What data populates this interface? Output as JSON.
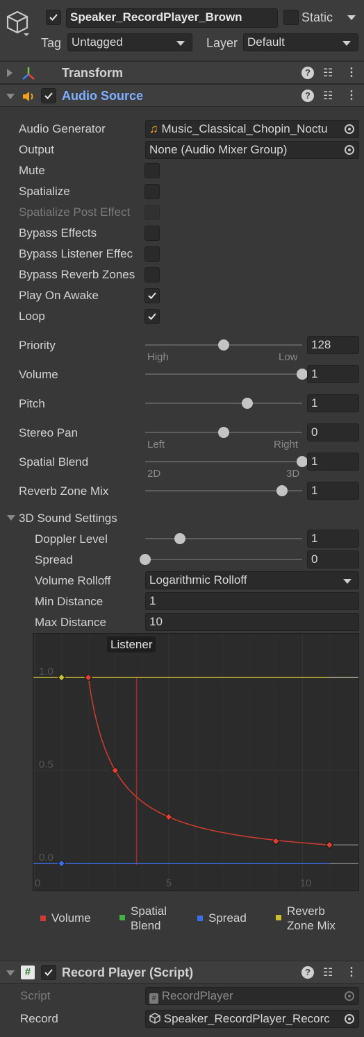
{
  "object": {
    "name": "Speaker_RecordPlayer_Brown",
    "static_label": "Static",
    "tag_label": "Tag",
    "tag_value": "Untagged",
    "layer_label": "Layer",
    "layer_value": "Default"
  },
  "transform": {
    "title": "Transform"
  },
  "audio_source": {
    "title": "Audio Source",
    "audio_generator_label": "Audio Generator",
    "audio_generator_value": "Music_Classical_Chopin_Noctu",
    "output_label": "Output",
    "output_value": "None (Audio Mixer Group)",
    "mute_label": "Mute",
    "spatialize_label": "Spatialize",
    "spatialize_post_label": "Spatialize Post Effect",
    "bypass_effects_label": "Bypass Effects",
    "bypass_listener_label": "Bypass Listener Effec",
    "bypass_reverb_label": "Bypass Reverb Zones",
    "play_on_awake_label": "Play On Awake",
    "loop_label": "Loop",
    "checks": {
      "mute": false,
      "spatialize": false,
      "spatialize_post": false,
      "bypass_effects": false,
      "bypass_listener": false,
      "bypass_reverb": false,
      "play_on_awake": true,
      "loop": true
    },
    "priority": {
      "label": "Priority",
      "value": "128",
      "min_hint": "High",
      "max_hint": "Low",
      "fraction": 0.5
    },
    "volume": {
      "label": "Volume",
      "value": "1",
      "fraction": 1.0
    },
    "pitch": {
      "label": "Pitch",
      "value": "1",
      "fraction": 0.65
    },
    "stereo_pan": {
      "label": "Stereo Pan",
      "value": "0",
      "min_hint": "Left",
      "max_hint": "Right",
      "fraction": 0.5
    },
    "spatial_blend": {
      "label": "Spatial Blend",
      "value": "1",
      "min_hint": "2D",
      "max_hint": "3D",
      "fraction": 1.0
    },
    "reverb_zone_mix": {
      "label": "Reverb Zone Mix",
      "value": "1",
      "fraction": 0.87
    }
  },
  "sound3d": {
    "title": "3D Sound Settings",
    "doppler": {
      "label": "Doppler Level",
      "value": "1",
      "fraction": 0.22
    },
    "spread": {
      "label": "Spread",
      "value": "0",
      "fraction": 0.0
    },
    "rolloff_label": "Volume Rolloff",
    "rolloff_value": "Logarithmic Rolloff",
    "min_distance_label": "Min Distance",
    "min_distance_value": "1",
    "max_distance_label": "Max Distance",
    "max_distance_value": "10"
  },
  "chart_data": {
    "type": "line",
    "listener_label": "Listener",
    "listener_x": 3.8,
    "xlim": [
      0,
      11.2
    ],
    "ylim": [
      0,
      1.1
    ],
    "x_ticks": [
      "0",
      "5",
      "10"
    ],
    "y_ticks": [
      "0.0",
      "0.5",
      "1.0"
    ],
    "series": [
      {
        "name": "Volume",
        "color": "#d23c2e",
        "x": [
          2,
          3,
          5,
          9,
          11
        ],
        "y": [
          1.0,
          0.5,
          0.25,
          0.12,
          0.1
        ]
      },
      {
        "name": "Spatial Blend",
        "color": "#44b044",
        "x": [
          1,
          11
        ],
        "y": [
          1.0,
          1.0
        ]
      },
      {
        "name": "Spread",
        "color": "#3a6ee8",
        "x": [
          1,
          11
        ],
        "y": [
          0.0,
          0.0
        ]
      },
      {
        "name": "Reverb Zone Mix",
        "color": "#c8c030",
        "x": [
          1,
          11
        ],
        "y": [
          1.0,
          1.0
        ]
      }
    ],
    "legend": [
      "Volume",
      "Spatial Blend",
      "Spread",
      "Reverb Zone Mix"
    ],
    "legend_lines": [
      [
        "Volume"
      ],
      [
        "Spatial",
        "Blend"
      ],
      [
        "Spread"
      ],
      [
        "Reverb",
        "Zone Mix"
      ]
    ]
  },
  "record_player": {
    "title": "Record Player (Script)",
    "script_label": "Script",
    "script_value": "RecordPlayer",
    "record_label": "Record",
    "record_value": "Speaker_RecordPlayer_Recorc"
  }
}
